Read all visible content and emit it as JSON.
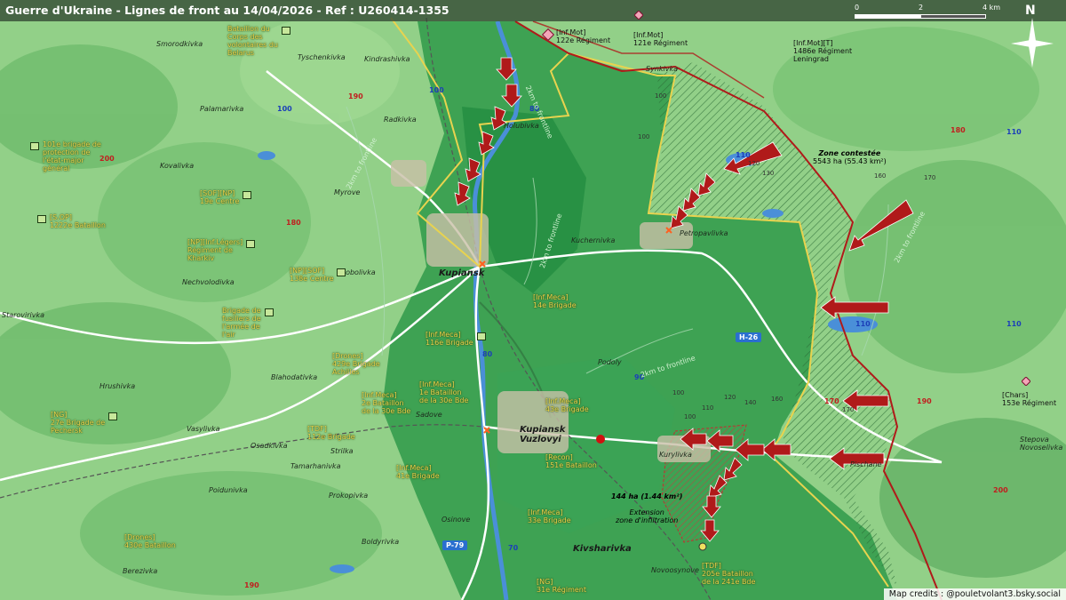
{
  "header": {
    "title": "Guerre d'Ukraine - Lignes de front au 14/04/2026 - Ref : U260414-1355",
    "scale_labels": [
      "0",
      "2",
      "4 km"
    ],
    "north": "N"
  },
  "credits": "Map credits : @pouletvolant3.bsky.social",
  "places": [
    "Smorodkivka",
    "Tyschenkivka",
    "Kindrashivka",
    "Palamarivka",
    "Radkivka",
    "Holubivka",
    "Kovalivka",
    "Synkivka",
    "Myrove",
    "Petropavlivka",
    "Kuchernivka",
    "Sobolivka",
    "Nechvolodivka",
    "Starovirivka",
    "Podoly",
    "Hrushivka",
    "Blahodativka",
    "Vasylivka",
    "Osadkivka",
    "Sadove",
    "Strilka",
    "Tamarhanivka",
    "Poidunivka",
    "Prokopivka",
    "Boldyrivka",
    "Osinove",
    "Berezivka",
    "Kurylivka",
    "Novoosynove",
    "Stepova Novoselivka",
    "Pischane"
  ],
  "towns": [
    "Kupiansk",
    "Kupiansk\nVuzlovyi",
    "Kivsharivka"
  ],
  "roads": {
    "red": [
      "190",
      "200",
      "180",
      "190",
      "180",
      "170",
      "200",
      "190"
    ],
    "blue": [
      "100",
      "100",
      "110",
      "110",
      "110",
      "80",
      "80",
      "90",
      "70",
      "110"
    ],
    "badges": [
      "H-26",
      "P-79"
    ]
  },
  "altitudes": [
    "100",
    "100",
    "120",
    "130",
    "160",
    "170",
    "100",
    "120",
    "140",
    "160",
    "170",
    "110",
    "100"
  ],
  "frontline_labels": [
    "2km to frontline",
    "2km to frontline",
    "2km to frontline",
    "2km to frontline",
    "2km to frontline"
  ],
  "units_ua": [
    "Bataillon du\nCorps des\nvolontaires du\nBelarus",
    "101e brigade de\nprotection de\nl'état-major\ngénéral",
    "[SOF][NP]\n19e Centre",
    "[S.OP]\n1222e Bataillon",
    "[NP][Inf.Légers]\nRégiment de\nKharkiv",
    "[NP][SOF]\n138e Centre",
    "Brigade de\nfusiliers de\nl'armée de\nl'air",
    "[Inf.Meca]\n116e Brigade",
    "[Inf.Meca]\n14e Brigade",
    "[Drones]\n429e Brigade\nAchilles",
    "[Inf.Meca]\n2e Bataillon\nde la 30e Bde",
    "[Inf.Meca]\n1e Bataillon\nde la 30e Bde",
    "[Inf.Meca]\n43e Brigade",
    "[NG]\n27e Brigade de\nPechersk",
    "[TDF]\n112e Brigade",
    "[Inf.Meca]\n41e Brigade",
    "[Recon]\n151e Bataillon",
    "[Inf.Meca]\n33e Brigade",
    "[Drones]\n430e Bataillon",
    "[TDF]\n205e Bataillon\nde la 241e Bde",
    "[NG]\n31e Régiment"
  ],
  "units_ru": [
    "[Inf.Mot]\n122e Régiment",
    "[Inf.Mot]\n121e Régiment",
    "[Inf.Mot][T]\n1486e Régiment\nLeningrad",
    "[Chars]\n153e Régiment"
  ],
  "zones": [
    {
      "title": "Zone contestée",
      "detail": "5543 ha (55.43 km²)"
    },
    {
      "title": "144 ha (1.44 km²)",
      "detail": "Extension\nzone d'infiltration"
    }
  ],
  "colors": {
    "light_green": "#8fcf84",
    "dark_green": "#2f9a4a",
    "contested": "#3d8a4a",
    "ua_line": "#e8d34f",
    "ru_line": "#b01a1a",
    "river": "#4a8fd8",
    "road": "#ffffff"
  }
}
